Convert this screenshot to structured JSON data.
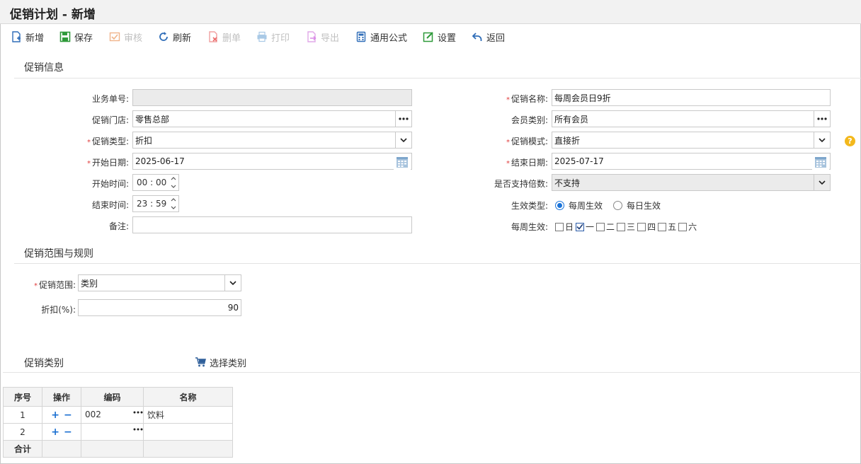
{
  "window": {
    "title": "促销计划 - 新增"
  },
  "toolbar": {
    "new": "新增",
    "save": "保存",
    "audit": "审核",
    "refresh": "刷新",
    "delete": "删单",
    "print": "打印",
    "export": "导出",
    "formula": "通用公式",
    "settings": "设置",
    "back": "返回"
  },
  "sections": {
    "info": "促销信息",
    "range": "促销范围与规则",
    "category": "促销类别",
    "select_category": "选择类别"
  },
  "form": {
    "doc_no": {
      "label": "业务单号:",
      "value": ""
    },
    "store": {
      "label": "促销门店:",
      "value": "零售总部"
    },
    "promo_type": {
      "label": "促销类型:",
      "value": "折扣"
    },
    "start_date": {
      "label": "开始日期:",
      "value": "2025-06-17"
    },
    "start_time": {
      "label": "开始时间:",
      "value": "00 : 00"
    },
    "end_time": {
      "label": "结束时间:",
      "value": "23 : 59"
    },
    "remark": {
      "label": "备注:",
      "value": ""
    },
    "promo_name": {
      "label": "促销名称:",
      "value": "每周会员日9折"
    },
    "member_type": {
      "label": "会员类别:",
      "value": "所有会员"
    },
    "promo_mode": {
      "label": "促销模式:",
      "value": "直接折"
    },
    "end_date": {
      "label": "结束日期:",
      "value": "2025-07-17"
    },
    "multiple": {
      "label": "是否支持倍数:",
      "value": "不支持"
    },
    "effect_type": {
      "label": "生效类型:",
      "options": [
        "每周生效",
        "每日生效"
      ],
      "selected": "每周生效"
    },
    "weekly": {
      "label": "每周生效:",
      "days": [
        "日",
        "一",
        "二",
        "三",
        "四",
        "五",
        "六"
      ],
      "checked": [
        "一"
      ]
    },
    "scope": {
      "label": "促销范围:",
      "value": "类别"
    },
    "discount": {
      "label": "折扣(%):",
      "value": "90"
    }
  },
  "grid": {
    "headers": [
      "序号",
      "操作",
      "编码",
      "名称"
    ],
    "rows": [
      {
        "no": "1",
        "code": "002",
        "name": "饮料"
      },
      {
        "no": "2",
        "code": "",
        "name": ""
      }
    ],
    "total_label": "合计"
  },
  "colors": {
    "accent": "#1a73d9",
    "required": "#e03c3c",
    "help": "#f3b81c"
  }
}
